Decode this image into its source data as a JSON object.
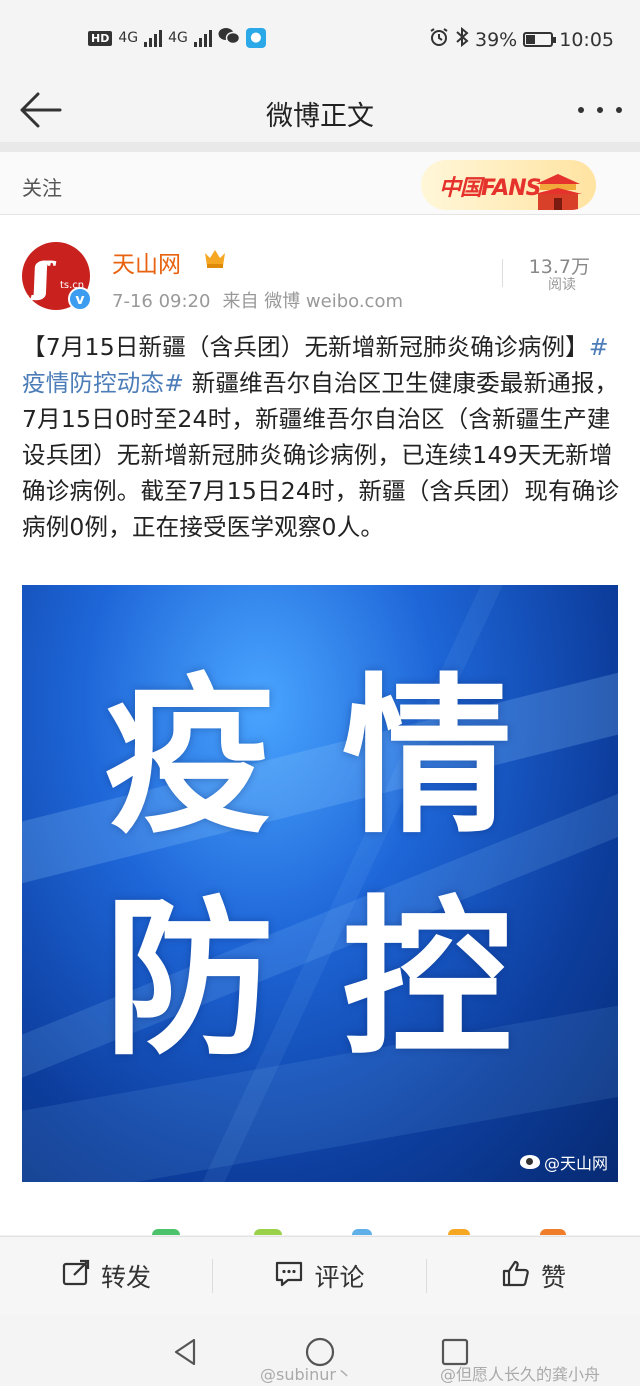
{
  "status_bar": {
    "hd": "HD",
    "net1": "4G",
    "net2": "4G",
    "battery_percent": "39%",
    "battery_level": 0.39,
    "time": "10:05"
  },
  "nav": {
    "title": "微博正文"
  },
  "follow_bar": {
    "label": "关注",
    "badge_text": "中国FANS"
  },
  "post": {
    "avatar_text": "ts.cn",
    "author": "天山网",
    "timestamp": "7-16 09:20",
    "source_prefix": "来自",
    "source": "微博 weibo.com",
    "read_count": "13.7万",
    "read_label": "阅读",
    "body_part1": "【7月15日新疆（含兵团）无新增新冠肺炎确诊病例】",
    "hashtag": "#疫情防控动态#",
    "body_part2": " 新疆维吾尔自治区卫生健康委最新通报，7月15日0时至24时，新疆维吾尔自治区（含新疆生产建设兵团）无新增新冠肺炎确诊病例，已连续149天无新增确诊病例。截至7月15日24时，新疆（含兵团）现有确诊病例0例，正在接受医学观察0人。",
    "image": {
      "chars": [
        "疫",
        "情",
        "防",
        "控"
      ],
      "watermark": "@天山网"
    }
  },
  "actions": {
    "repost": "转发",
    "comment": "评论",
    "like": "赞"
  },
  "footer": {
    "tag1": "@subinur丶",
    "tag2": "@但愿人长久的龚小舟"
  }
}
